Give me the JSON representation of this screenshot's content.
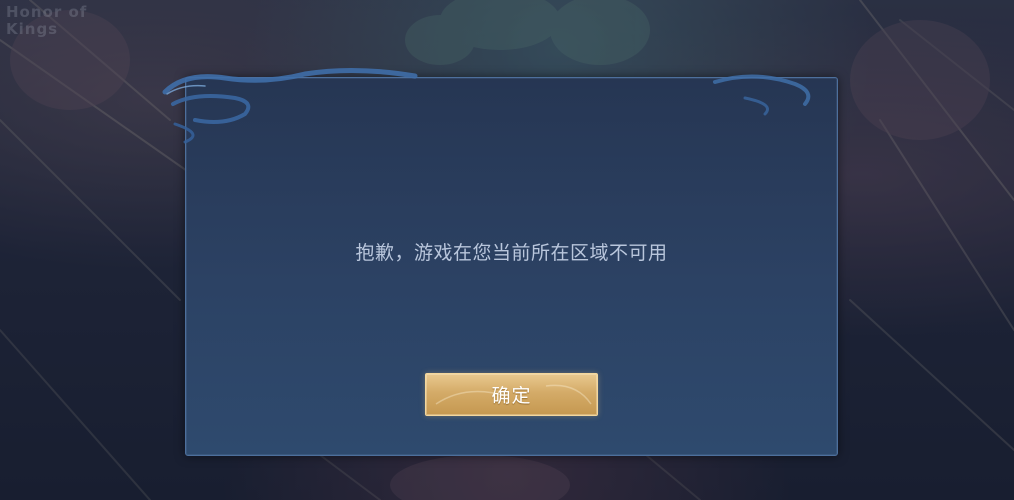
{
  "background": {
    "logo_text_line1": "Honor of",
    "logo_text_line2": "Kings"
  },
  "dialog": {
    "message": "抱歉，游戏在您当前所在区域不可用",
    "confirm_label": "确定"
  },
  "colors": {
    "dialog_bg": "#2c4264",
    "dialog_border": "#4d6f9c",
    "message_text": "#b9c6dc",
    "button_gold": "#d4ab68",
    "button_text": "#ffffff"
  }
}
